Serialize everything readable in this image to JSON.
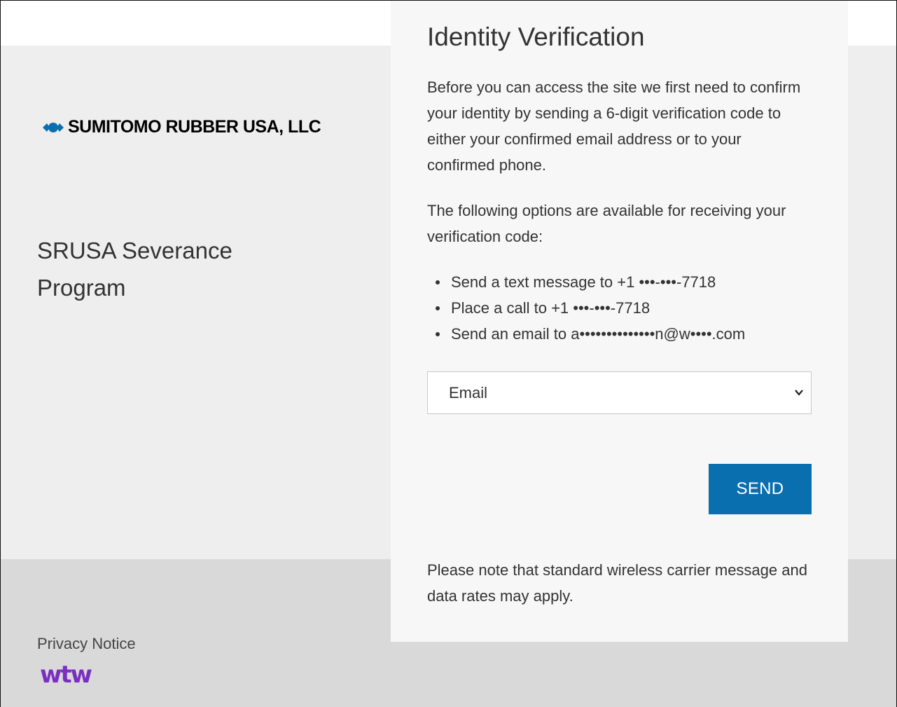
{
  "sidebar": {
    "logo_text": "SUMITOMO RUBBER USA, LLC",
    "logo_icon": "sumitomo-diamond-mark",
    "program_title": "SRUSA Severance Program"
  },
  "card": {
    "title": "Identity Verification",
    "intro": "Before you can access the site we first need to confirm your identity by sending a 6-digit verification code to either your confirmed email address or to your confirmed phone.",
    "options_intro": "The following options are available for receiving your verification code:",
    "options": [
      "Send a text message to +1 •••-•••-7718",
      "Place a call to +1 •••-•••-7718",
      "Send an email to a••••••••••••••n@w••••.com"
    ],
    "method_select": {
      "selected": "Email"
    },
    "send_label": "SEND",
    "note": "Please note that standard wireless carrier message and data rates may apply."
  },
  "footer": {
    "privacy_label": "Privacy Notice",
    "brand": "wtw"
  },
  "colors": {
    "accent": "#0a6fae",
    "brand_purple": "#7b2fc2",
    "panel_gray": "#eeeeee",
    "footer_gray": "#d9d9d9"
  }
}
